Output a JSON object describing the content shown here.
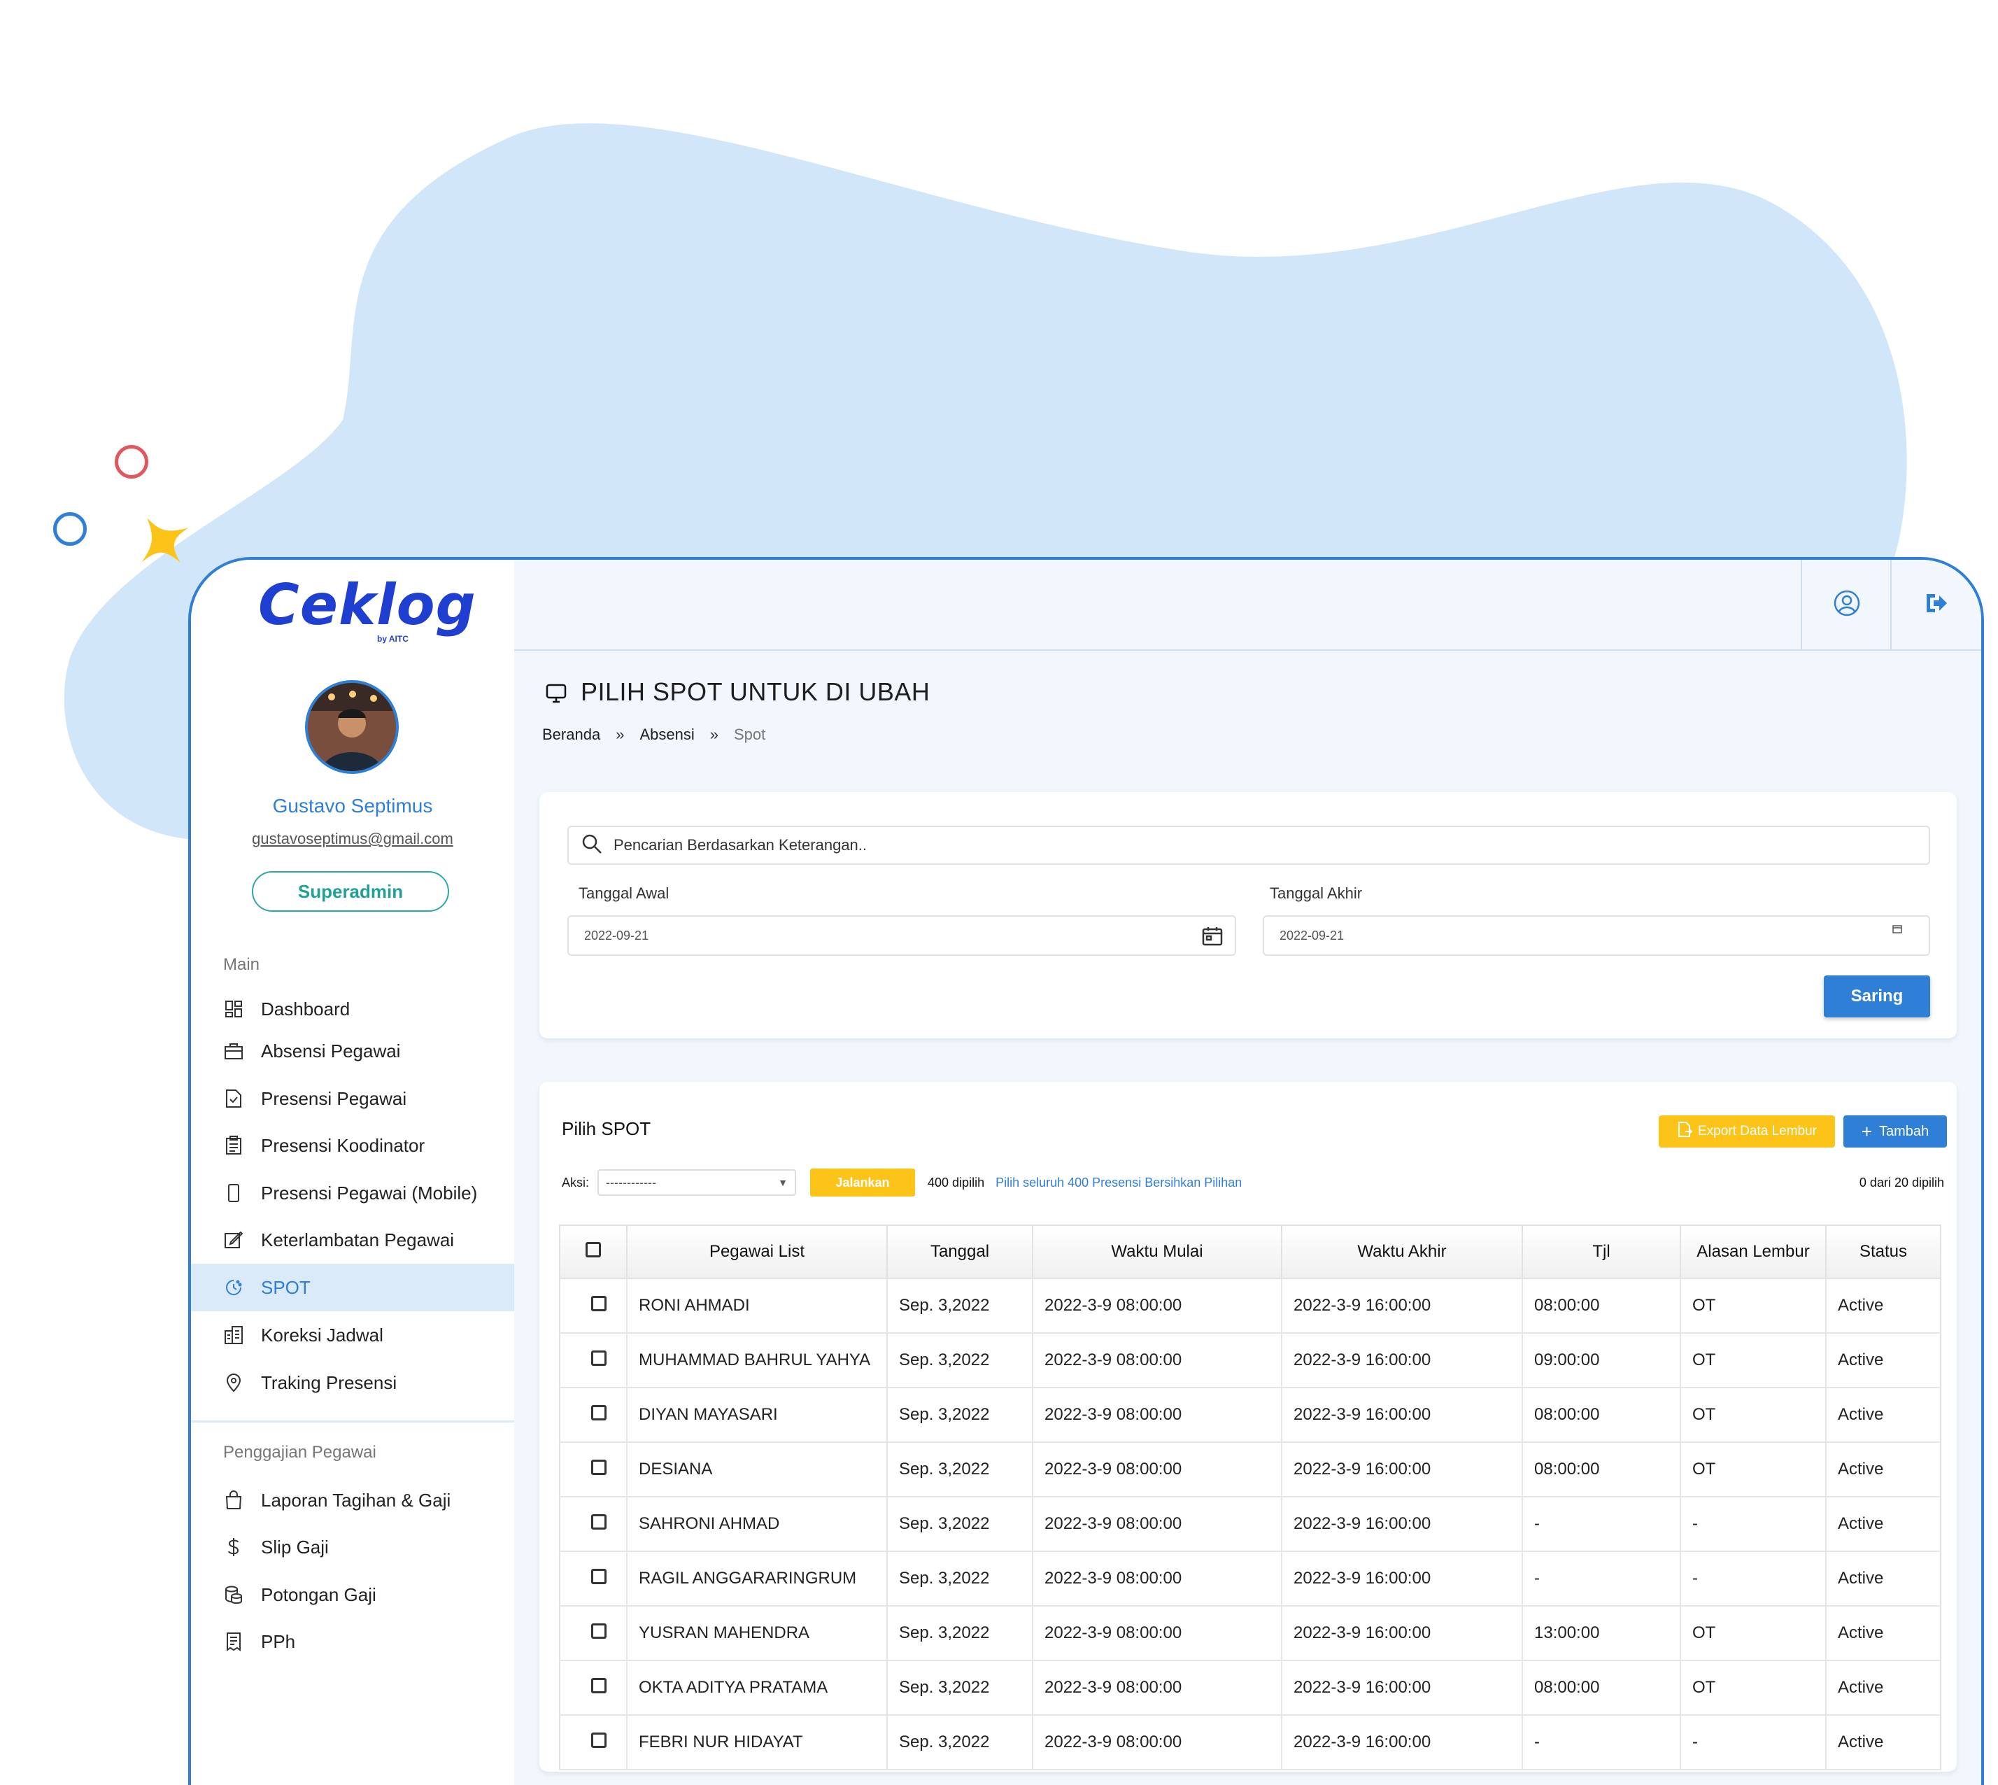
{
  "brand": {
    "name": "Ceklog",
    "sub": "by AITC",
    "color": "#1f3fd1",
    "accent": "#2f7fd6"
  },
  "user": {
    "name": "Gustavo Septimus",
    "email": "gustavoseptimus@gmail.com",
    "role": "Superadmin"
  },
  "sidebar": {
    "sections": [
      {
        "label": "Main"
      },
      {
        "label": "Penggajian Pegawai"
      }
    ],
    "items": [
      {
        "label": "Dashboard",
        "icon": "dashboard-icon"
      },
      {
        "label": "Absensi Pegawai",
        "icon": "briefcase-icon"
      },
      {
        "label": "Presensi Pegawai",
        "icon": "file-check-icon"
      },
      {
        "label": "Presensi Koodinator",
        "icon": "clipboard-icon"
      },
      {
        "label": "Presensi Pegawai (Mobile)",
        "icon": "mobile-icon"
      },
      {
        "label": "Keterlambatan Pegawai",
        "icon": "edit-icon"
      },
      {
        "label": "SPOT",
        "icon": "clock-icon",
        "active": true
      },
      {
        "label": "Koreksi Jadwal",
        "icon": "building-icon"
      },
      {
        "label": "Traking Presensi",
        "icon": "location-icon"
      },
      {
        "label": "Laporan Tagihan & Gaji",
        "icon": "bag-icon"
      },
      {
        "label": "Slip Gaji",
        "icon": "dollar-icon"
      },
      {
        "label": "Potongan Gaji",
        "icon": "coins-icon"
      },
      {
        "label": "PPh",
        "icon": "receipt-icon"
      }
    ]
  },
  "header": {
    "title": "PILIH SPOT UNTUK DI UBAH",
    "breadcrumb": [
      "Beranda",
      "Absensi",
      "Spot"
    ]
  },
  "filter": {
    "search_placeholder": "Pencarian Berdasarkan Keterangan..",
    "start_label": "Tanggal Awal",
    "start_value": "2022-09-21",
    "end_label": "Tanggal Akhir",
    "end_value": "2022-09-21",
    "submit": "Saring"
  },
  "list": {
    "title": "Pilih SPOT",
    "export_label": "Export Data Lembur",
    "add_label": "Tambah",
    "aksi_label": "Aksi:",
    "aksi_value": "------------",
    "run_label": "Jalankan",
    "selected_count": "400 dipilih",
    "select_all_link": "Pilih seluruh 400 Presensi Bersihkan Pilihan",
    "selected_right": "0 dari 20 dipilih",
    "columns": [
      "Pegawai List",
      "Tanggal",
      "Waktu Mulai",
      "Waktu  Akhir",
      "Tjl",
      "Alasan Lembur",
      "Status"
    ],
    "rows": [
      {
        "name": "RONI AHMADI",
        "date": "Sep. 3,2022",
        "start": "2022-3-9 08:00:00",
        "end": "2022-3-9 16:00:00",
        "tjl": "08:00:00",
        "reason": "OT",
        "status": "Active"
      },
      {
        "name": "MUHAMMAD BAHRUL YAHYA",
        "date": "Sep. 3,2022",
        "start": "2022-3-9 08:00:00",
        "end": "2022-3-9 16:00:00",
        "tjl": "09:00:00",
        "reason": "OT",
        "status": "Active"
      },
      {
        "name": "DIYAN MAYASARI",
        "date": "Sep. 3,2022",
        "start": "2022-3-9 08:00:00",
        "end": "2022-3-9 16:00:00",
        "tjl": "08:00:00",
        "reason": "OT",
        "status": "Active"
      },
      {
        "name": "DESIANA",
        "date": "Sep. 3,2022",
        "start": "2022-3-9 08:00:00",
        "end": "2022-3-9 16:00:00",
        "tjl": "08:00:00",
        "reason": "OT",
        "status": "Active"
      },
      {
        "name": "SAHRONI AHMAD",
        "date": "Sep. 3,2022",
        "start": "2022-3-9 08:00:00",
        "end": "2022-3-9 16:00:00",
        "tjl": "-",
        "reason": "-",
        "status": "Active"
      },
      {
        "name": "RAGIL ANGGARARINGRUM",
        "date": "Sep. 3,2022",
        "start": "2022-3-9 08:00:00",
        "end": "2022-3-9 16:00:00",
        "tjl": "-",
        "reason": "-",
        "status": "Active"
      },
      {
        "name": "YUSRAN MAHENDRA",
        "date": "Sep. 3,2022",
        "start": "2022-3-9 08:00:00",
        "end": "2022-3-9 16:00:00",
        "tjl": "13:00:00",
        "reason": "OT",
        "status": "Active"
      },
      {
        "name": "OKTA ADITYA PRATAMA",
        "date": "Sep. 3,2022",
        "start": "2022-3-9 08:00:00",
        "end": "2022-3-9 16:00:00",
        "tjl": "08:00:00",
        "reason": "OT",
        "status": "Active"
      },
      {
        "name": "FEBRI NUR HIDAYAT",
        "date": "Sep. 3,2022",
        "start": "2022-3-9 08:00:00",
        "end": "2022-3-9 16:00:00",
        "tjl": "-",
        "reason": "-",
        "status": "Active"
      }
    ]
  }
}
